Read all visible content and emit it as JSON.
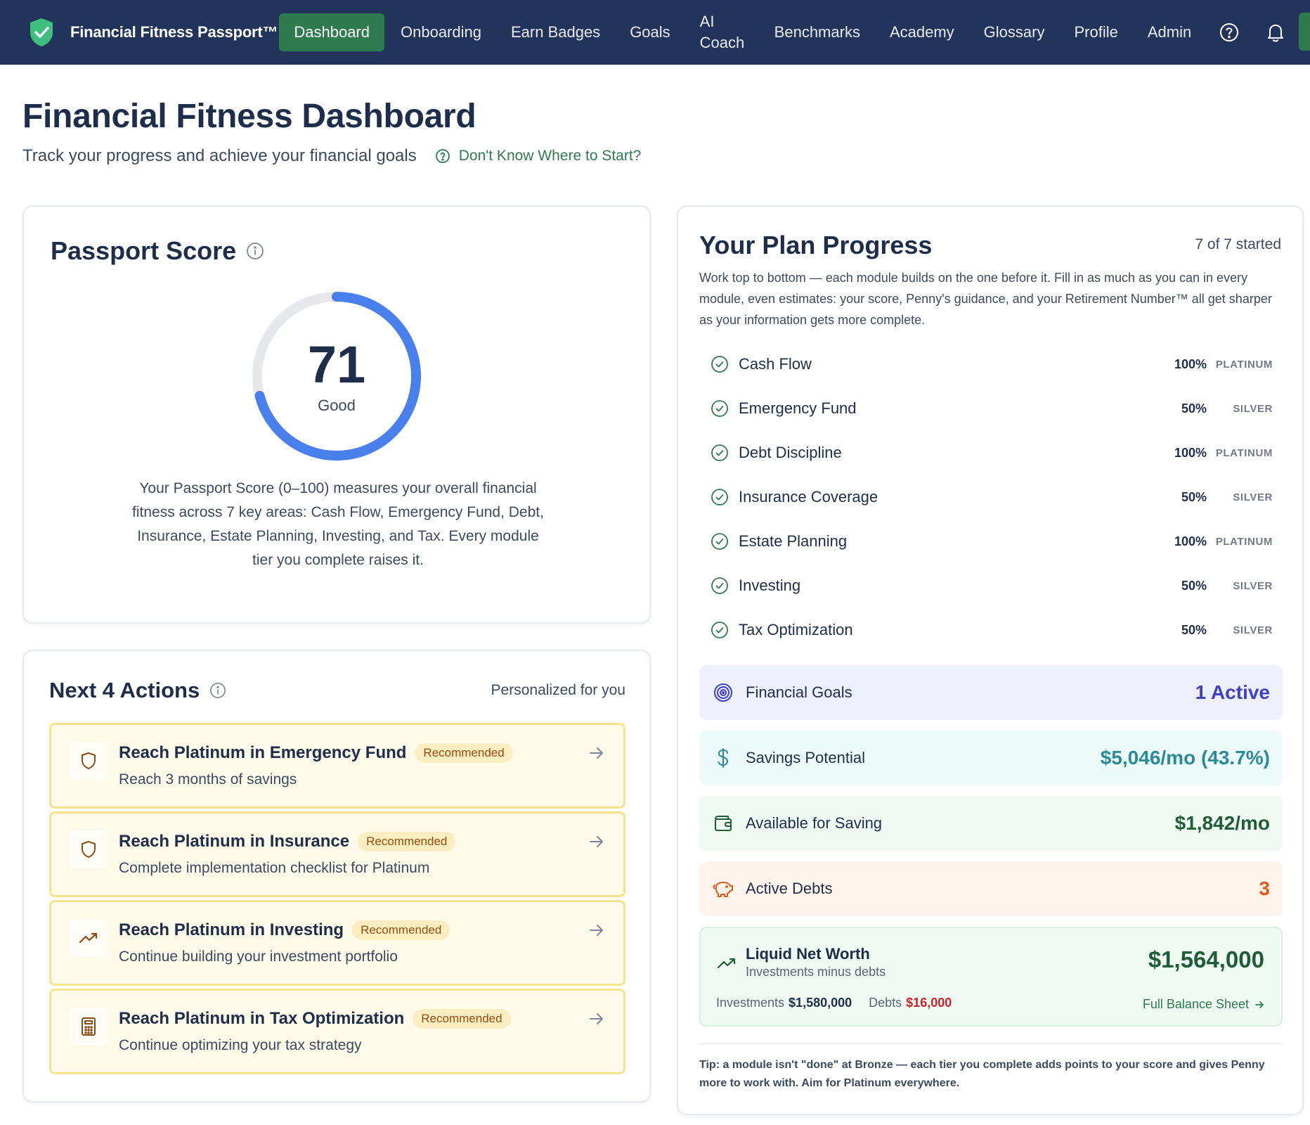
{
  "nav": {
    "brand": "Financial Fitness Passport™",
    "items": [
      {
        "label": "Dashboard"
      },
      {
        "label": "Onboarding"
      },
      {
        "label": "Earn Badges"
      },
      {
        "label": "Goals"
      },
      {
        "label": "AI Coach"
      },
      {
        "label": "Benchmarks"
      },
      {
        "label": "Academy"
      },
      {
        "label": "Glossary"
      },
      {
        "label": "Profile"
      },
      {
        "label": "Admin"
      }
    ],
    "icons": [
      "help-icon",
      "bell-icon"
    ],
    "active": "Dashboard"
  },
  "header": {
    "title": "Financial Fitness Dashboard",
    "subtitle": "Track your progress and achieve your financial goals",
    "help_link": "Don't Know Where to Start?"
  },
  "score": {
    "title": "Passport Score",
    "value": "71",
    "max": 100,
    "rating": "Good",
    "description": "Your Passport Score (0–100) measures your overall financial fitness across 7 key areas: Cash Flow, Emergency Fund, Debt, Insurance, Estate Planning, Investing, and Tax. Every module tier you complete raises it."
  },
  "actions": {
    "title": "Next 4 Actions",
    "subtitle": "Personalized for you",
    "items": [
      {
        "title": "Reach Platinum in Emergency Fund",
        "badge": "Recommended",
        "desc": "Reach 3 months of savings",
        "icon": "shield-icon"
      },
      {
        "title": "Reach Platinum in Insurance",
        "badge": "Recommended",
        "desc": "Complete implementation checklist for Platinum",
        "icon": "shield-icon"
      },
      {
        "title": "Reach Platinum in Investing",
        "badge": "Recommended",
        "desc": "Continue building your investment portfolio",
        "icon": "trending-up-icon"
      },
      {
        "title": "Reach Platinum in Tax Optimization",
        "badge": "Recommended",
        "desc": "Continue optimizing your tax strategy",
        "icon": "calculator-icon"
      }
    ]
  },
  "plan": {
    "title": "Your Plan Progress",
    "count": "7 of 7 started",
    "description": "Work top to bottom — each module builds on the one before it. Fill in as much as you can in every module, even estimates: your score, Penny's guidance, and your Retirement Number™ all get sharper as your information gets more complete.",
    "modules": [
      {
        "name": "Cash Flow",
        "pct": "100%",
        "tier": "PLATINUM"
      },
      {
        "name": "Emergency Fund",
        "pct": "50%",
        "tier": "SILVER"
      },
      {
        "name": "Debt Discipline",
        "pct": "100%",
        "tier": "PLATINUM"
      },
      {
        "name": "Insurance Coverage",
        "pct": "50%",
        "tier": "SILVER"
      },
      {
        "name": "Estate Planning",
        "pct": "100%",
        "tier": "PLATINUM"
      },
      {
        "name": "Investing",
        "pct": "50%",
        "tier": "SILVER"
      },
      {
        "name": "Tax Optimization",
        "pct": "50%",
        "tier": "SILVER"
      }
    ],
    "stats": {
      "goals": {
        "label": "Financial Goals",
        "value": "1 Active",
        "icon": "target-icon",
        "color": "#3f3fc9",
        "bg": "#eef0fd"
      },
      "savings": {
        "label": "Savings Potential",
        "value": "$5,046/mo (43.7%)",
        "icon": "dollar-icon",
        "color": "#2a8a9c",
        "bg": "#eefbfb"
      },
      "available": {
        "label": "Available for Saving",
        "value": "$1,842/mo",
        "icon": "wallet-icon",
        "color": "#1f5c37",
        "bg": "#effaf3"
      },
      "debts": {
        "label": "Active Debts",
        "value": "3",
        "icon": "piggy-bank-icon",
        "color": "#e0591a",
        "bg": "#fff5ec"
      }
    },
    "networth": {
      "title": "Liquid Net Worth",
      "subtitle": "Investments minus debts",
      "value": "$1,564,000",
      "investments_label": "Investments",
      "investments_value": "$1,580,000",
      "debts_label": "Debts",
      "debts_value": "$16,000",
      "link": "Full Balance Sheet"
    },
    "tip": "Tip: a module isn't \"done\" at Bronze — each tier you complete adds points to your score and gives Penny more to work with. Aim for Platinum everywhere."
  },
  "colors": {
    "nav_bg": "#22345a",
    "accent_green": "#2f7a4f",
    "gauge_blue": "#4a80ee",
    "gauge_track": "#e6e8ec",
    "action_bg": "#fefaea",
    "action_border": "#f7e28d"
  }
}
